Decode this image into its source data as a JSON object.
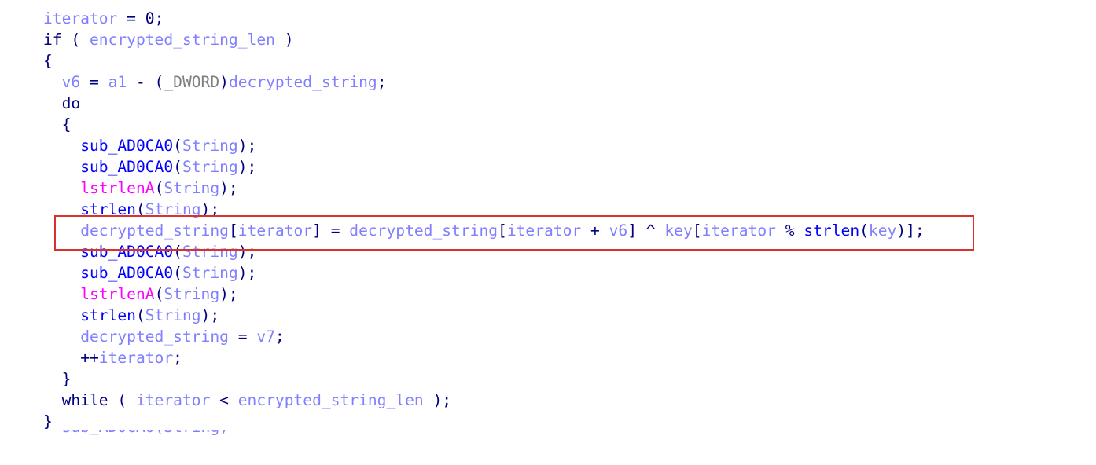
{
  "code_view": {
    "lines": [
      {
        "indent": "",
        "tokens": [
          {
            "t": "iterator",
            "k": "var"
          },
          {
            "t": " = ",
            "k": "punc"
          },
          {
            "t": "0",
            "k": "num"
          },
          {
            "t": ";",
            "k": "punc"
          }
        ]
      },
      {
        "indent": "",
        "tokens": [
          {
            "t": "if",
            "k": "kw"
          },
          {
            "t": " ( ",
            "k": "punc"
          },
          {
            "t": "encrypted_string_len",
            "k": "var"
          },
          {
            "t": " )",
            "k": "punc"
          }
        ]
      },
      {
        "indent": "",
        "tokens": [
          {
            "t": "{",
            "k": "punc"
          }
        ]
      },
      {
        "indent": "  ",
        "tokens": [
          {
            "t": "v6",
            "k": "var"
          },
          {
            "t": " = ",
            "k": "punc"
          },
          {
            "t": "a1",
            "k": "var"
          },
          {
            "t": " - (",
            "k": "punc"
          },
          {
            "t": "_DWORD",
            "k": "type"
          },
          {
            "t": ")",
            "k": "punc"
          },
          {
            "t": "decrypted_string",
            "k": "var"
          },
          {
            "t": ";",
            "k": "punc"
          }
        ]
      },
      {
        "indent": "  ",
        "tokens": [
          {
            "t": "do",
            "k": "kw"
          }
        ]
      },
      {
        "indent": "  ",
        "tokens": [
          {
            "t": "{",
            "k": "punc"
          }
        ]
      },
      {
        "indent": "    ",
        "tokens": [
          {
            "t": "sub_AD0CA0",
            "k": "func"
          },
          {
            "t": "(",
            "k": "punc"
          },
          {
            "t": "String",
            "k": "var"
          },
          {
            "t": ");",
            "k": "punc"
          }
        ]
      },
      {
        "indent": "    ",
        "tokens": [
          {
            "t": "sub_AD0CA0",
            "k": "func"
          },
          {
            "t": "(",
            "k": "punc"
          },
          {
            "t": "String",
            "k": "var"
          },
          {
            "t": ");",
            "k": "punc"
          }
        ]
      },
      {
        "indent": "    ",
        "tokens": [
          {
            "t": "lstrlenA",
            "k": "import"
          },
          {
            "t": "(",
            "k": "punc"
          },
          {
            "t": "String",
            "k": "var"
          },
          {
            "t": ");",
            "k": "punc"
          }
        ]
      },
      {
        "indent": "    ",
        "tokens": [
          {
            "t": "strlen",
            "k": "func"
          },
          {
            "t": "(",
            "k": "punc"
          },
          {
            "t": "String",
            "k": "var"
          },
          {
            "t": ");",
            "k": "punc"
          }
        ]
      },
      {
        "indent": "    ",
        "highlighted": true,
        "tokens": [
          {
            "t": "decrypted_string",
            "k": "var"
          },
          {
            "t": "[",
            "k": "punc"
          },
          {
            "t": "iterator",
            "k": "var"
          },
          {
            "t": "] = ",
            "k": "punc"
          },
          {
            "t": "decrypted_string",
            "k": "var"
          },
          {
            "t": "[",
            "k": "punc"
          },
          {
            "t": "iterator",
            "k": "var"
          },
          {
            "t": " + ",
            "k": "punc"
          },
          {
            "t": "v6",
            "k": "var"
          },
          {
            "t": "] ^ ",
            "k": "punc"
          },
          {
            "t": "key",
            "k": "var"
          },
          {
            "t": "[",
            "k": "punc"
          },
          {
            "t": "iterator",
            "k": "var"
          },
          {
            "t": " % ",
            "k": "punc"
          },
          {
            "t": "strlen",
            "k": "func"
          },
          {
            "t": "(",
            "k": "punc"
          },
          {
            "t": "key",
            "k": "var"
          },
          {
            "t": ")];",
            "k": "punc"
          }
        ]
      },
      {
        "indent": "    ",
        "tokens": [
          {
            "t": "sub_AD0CA0",
            "k": "func"
          },
          {
            "t": "(",
            "k": "punc"
          },
          {
            "t": "String",
            "k": "var"
          },
          {
            "t": ");",
            "k": "punc"
          }
        ]
      },
      {
        "indent": "    ",
        "tokens": [
          {
            "t": "sub_AD0CA0",
            "k": "func"
          },
          {
            "t": "(",
            "k": "punc"
          },
          {
            "t": "String",
            "k": "var"
          },
          {
            "t": ");",
            "k": "punc"
          }
        ]
      },
      {
        "indent": "    ",
        "tokens": [
          {
            "t": "lstrlenA",
            "k": "import"
          },
          {
            "t": "(",
            "k": "punc"
          },
          {
            "t": "String",
            "k": "var"
          },
          {
            "t": ");",
            "k": "punc"
          }
        ]
      },
      {
        "indent": "    ",
        "tokens": [
          {
            "t": "strlen",
            "k": "func"
          },
          {
            "t": "(",
            "k": "punc"
          },
          {
            "t": "String",
            "k": "var"
          },
          {
            "t": ");",
            "k": "punc"
          }
        ]
      },
      {
        "indent": "    ",
        "tokens": [
          {
            "t": "decrypted_string",
            "k": "var"
          },
          {
            "t": " = ",
            "k": "punc"
          },
          {
            "t": "v7",
            "k": "var"
          },
          {
            "t": ";",
            "k": "punc"
          }
        ]
      },
      {
        "indent": "    ",
        "tokens": [
          {
            "t": "++",
            "k": "punc"
          },
          {
            "t": "iterator",
            "k": "var"
          },
          {
            "t": ";",
            "k": "punc"
          }
        ]
      },
      {
        "indent": "  ",
        "tokens": [
          {
            "t": "}",
            "k": "punc"
          }
        ]
      },
      {
        "indent": "  ",
        "tokens": [
          {
            "t": "while",
            "k": "kw"
          },
          {
            "t": " ( ",
            "k": "punc"
          },
          {
            "t": "iterator",
            "k": "var"
          },
          {
            "t": " < ",
            "k": "punc"
          },
          {
            "t": "encrypted_string_len",
            "k": "var"
          },
          {
            "t": " );",
            "k": "punc"
          }
        ]
      },
      {
        "indent": "",
        "tokens": [
          {
            "t": "}",
            "k": "punc"
          }
        ]
      }
    ],
    "partial_line_text": "  sub_AD0CA0(String);",
    "highlight_color": "#d9322b",
    "colors": {
      "keyword": "#000080",
      "variable": "#8080ff",
      "function": "#0000ff",
      "import": "#ff00ff",
      "type": "#808080"
    }
  }
}
